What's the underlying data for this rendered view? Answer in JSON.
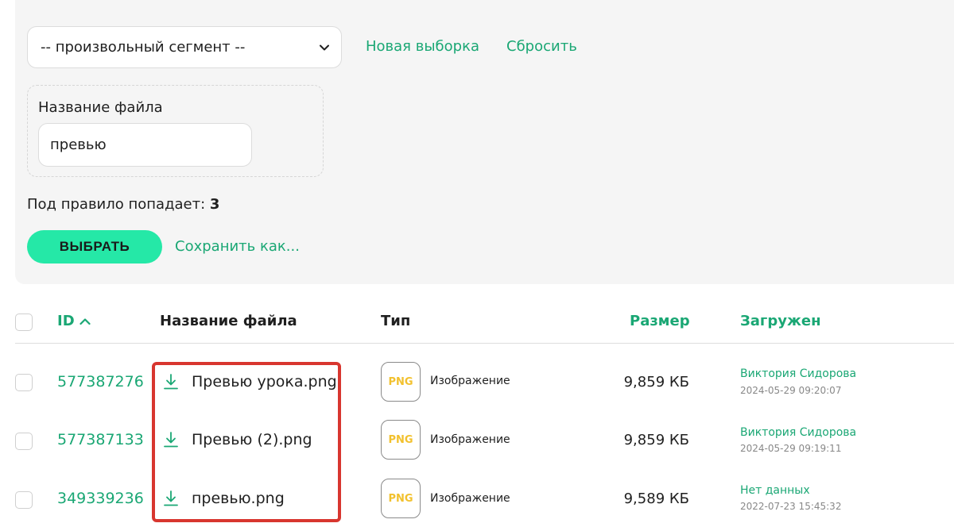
{
  "filter": {
    "segment_value": "-- произвольный сегмент --",
    "new_selection": "Новая выборка",
    "reset": "Сбросить",
    "rule_label": "Название файла",
    "rule_value": "превью",
    "count_label": "Под правило попадает:",
    "count_value": "3",
    "select_button": "ВЫБРАТЬ",
    "save_as": "Сохранить как..."
  },
  "table": {
    "headers": {
      "id": "ID",
      "name": "Название файла",
      "type": "Тип",
      "size": "Размер",
      "uploaded": "Загружен"
    },
    "rows": [
      {
        "id": "577387276",
        "name": "Превью урока.png",
        "badge": "PNG",
        "type": "Изображение",
        "size": "9,859 КБ",
        "uploader": "Виктория Сидорова",
        "date": "2024-05-29 09:20:07"
      },
      {
        "id": "577387133",
        "name": "Превью (2).png",
        "badge": "PNG",
        "type": "Изображение",
        "size": "9,859 КБ",
        "uploader": "Виктория Сидорова",
        "date": "2024-05-29 09:19:11"
      },
      {
        "id": "349339236",
        "name": "превью.png",
        "badge": "PNG",
        "type": "Изображение",
        "size": "9,589 КБ",
        "uploader": "Нет данных",
        "date": "2022-07-23 15:45:32"
      }
    ]
  },
  "colors": {
    "accent": "#1aa774",
    "button": "#25e8a7",
    "highlight": "#d8362f",
    "png_badge": "#f2c12e"
  }
}
